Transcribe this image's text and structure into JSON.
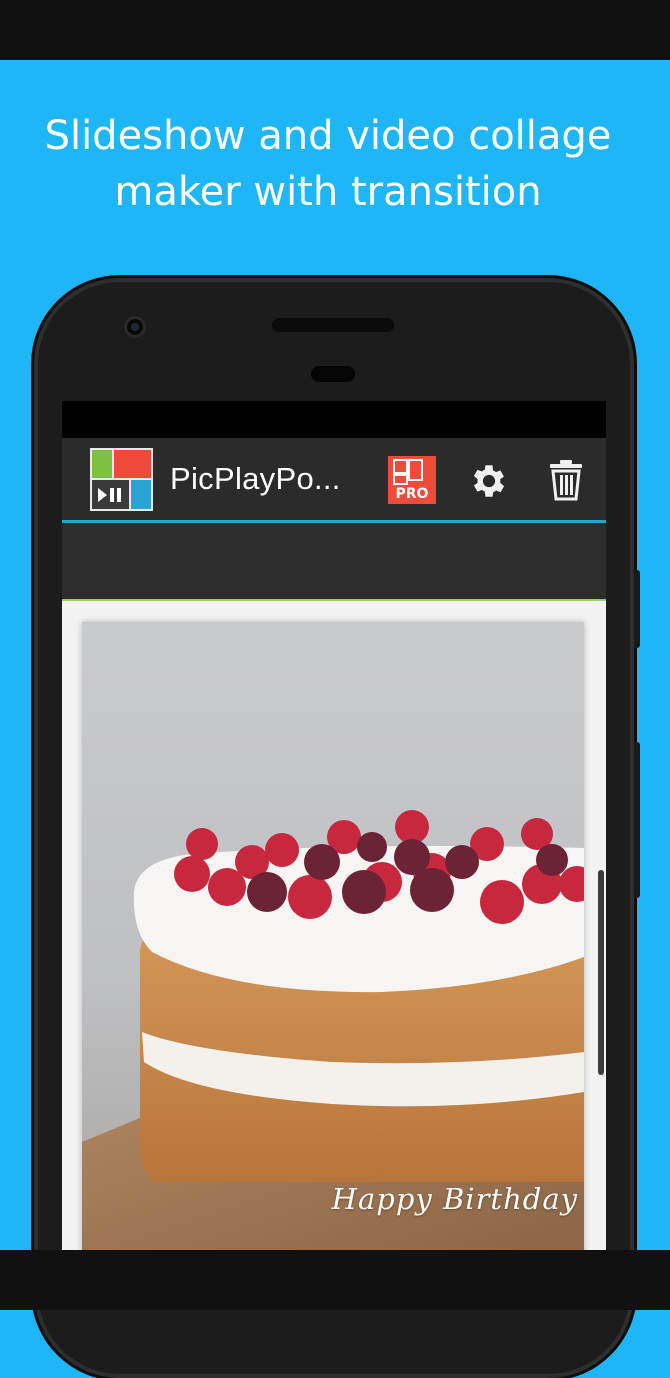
{
  "promo": {
    "headline_line1": "Slideshow and video collage",
    "headline_line2": "maker with transition"
  },
  "appbar": {
    "title": "PicPlayPo...",
    "pro_label": "PRO",
    "icons": [
      "app-logo-icon",
      "pro-collage-icon",
      "gear-icon",
      "trash-icon"
    ]
  },
  "canvas": {
    "caption": "Happy Birthday"
  },
  "colors": {
    "background": "#1fb6f8",
    "appbar": "#2b2b2b",
    "accent_line": "#27a3d6",
    "pro_red": "#ef4b3b"
  }
}
